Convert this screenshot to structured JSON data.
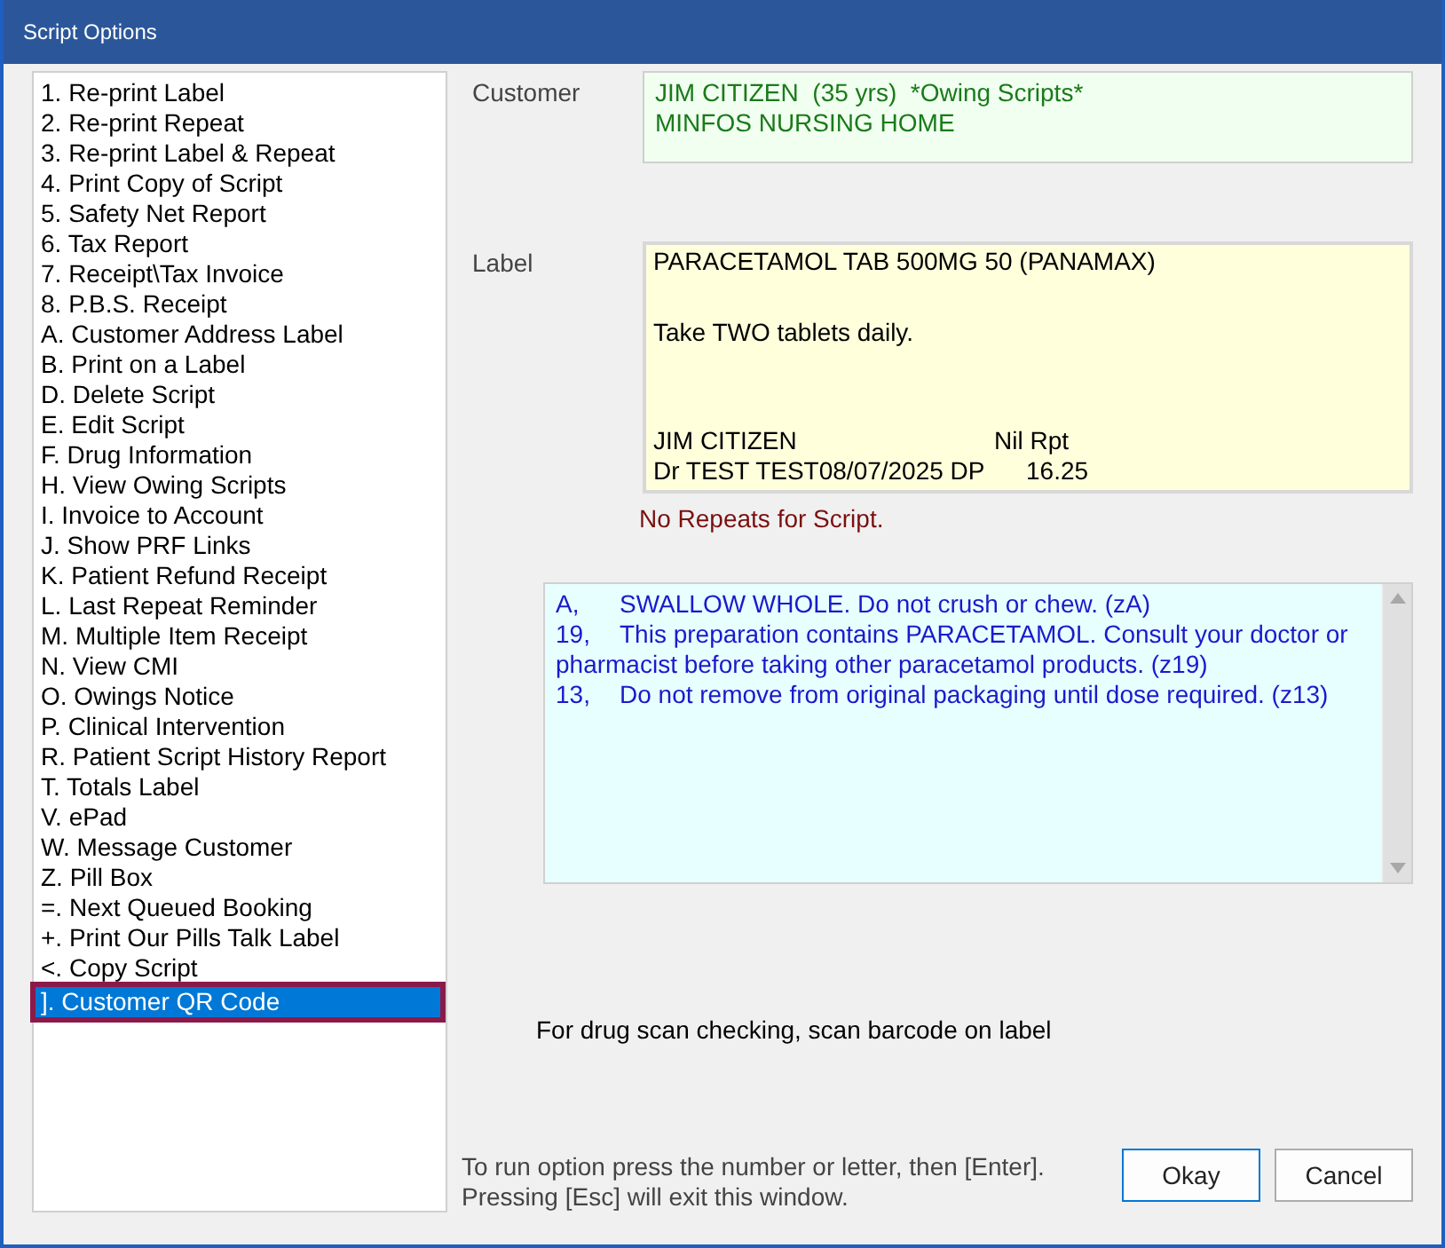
{
  "window": {
    "title": "Script Options"
  },
  "options": [
    {
      "label": "1. Re-print Label",
      "selected": false
    },
    {
      "label": "2. Re-print Repeat",
      "selected": false
    },
    {
      "label": "3. Re-print Label & Repeat",
      "selected": false
    },
    {
      "label": "4. Print Copy of Script",
      "selected": false
    },
    {
      "label": "5. Safety Net Report",
      "selected": false
    },
    {
      "label": "6. Tax Report",
      "selected": false
    },
    {
      "label": "7. Receipt\\Tax Invoice",
      "selected": false
    },
    {
      "label": "8. P.B.S. Receipt",
      "selected": false
    },
    {
      "label": "A. Customer Address Label",
      "selected": false
    },
    {
      "label": "B. Print on a Label",
      "selected": false
    },
    {
      "label": "D. Delete Script",
      "selected": false
    },
    {
      "label": "E. Edit Script",
      "selected": false
    },
    {
      "label": "F. Drug Information",
      "selected": false
    },
    {
      "label": "H. View Owing Scripts",
      "selected": false
    },
    {
      "label": "I. Invoice to Account",
      "selected": false
    },
    {
      "label": "J. Show PRF Links",
      "selected": false
    },
    {
      "label": "K. Patient Refund Receipt",
      "selected": false
    },
    {
      "label": "L. Last Repeat Reminder",
      "selected": false
    },
    {
      "label": "M. Multiple Item Receipt",
      "selected": false
    },
    {
      "label": "N. View CMI",
      "selected": false
    },
    {
      "label": "O. Owings Notice",
      "selected": false
    },
    {
      "label": "P. Clinical Intervention",
      "selected": false
    },
    {
      "label": "R. Patient Script History Report",
      "selected": false
    },
    {
      "label": "T. Totals Label",
      "selected": false
    },
    {
      "label": "V. ePad",
      "selected": false
    },
    {
      "label": "W. Message Customer",
      "selected": false
    },
    {
      "label": "Z. Pill Box",
      "selected": false
    },
    {
      "label": "=. Next Queued Booking",
      "selected": false
    },
    {
      "label": "+. Print Our Pills Talk Label",
      "selected": false
    },
    {
      "label": "<. Copy Script",
      "selected": false
    },
    {
      "label": "]. Customer QR Code",
      "selected": true
    }
  ],
  "customer": {
    "label": "Customer",
    "lines": [
      "JIM CITIZEN  (35 yrs)  *Owing Scripts*",
      "MINFOS NURSING HOME"
    ]
  },
  "label": {
    "label": "Label",
    "drug": "PARACETAMOL TAB 500MG 50 (PANAMAX)",
    "directions": "Take TWO tablets daily.",
    "patient": "JIM CITIZEN",
    "repeats": "Nil Rpt",
    "prescriber": "Dr TEST TEST08/07/2025 DP",
    "price": "16.25"
  },
  "repeat_notice": "No Repeats for Script.",
  "warnings": [
    {
      "code": "A,",
      "text": "SWALLOW WHOLE. Do not crush or chew. (zA)"
    },
    {
      "code": "19,",
      "text": "This preparation contains PARACETAMOL. Consult your doctor or pharmacist before taking other paracetamol products. (z19)"
    },
    {
      "code": "13,",
      "text": "Do not remove from original packaging until dose required. (z13)"
    }
  ],
  "scan_hint": "For drug scan checking, scan barcode on label",
  "help": [
    "To run option press the number or letter, then [Enter].",
    "Pressing [Esc] will exit this window."
  ],
  "buttons": [
    {
      "label": "Okay",
      "kind": "default"
    },
    {
      "label": "Cancel",
      "kind": "normal"
    }
  ]
}
